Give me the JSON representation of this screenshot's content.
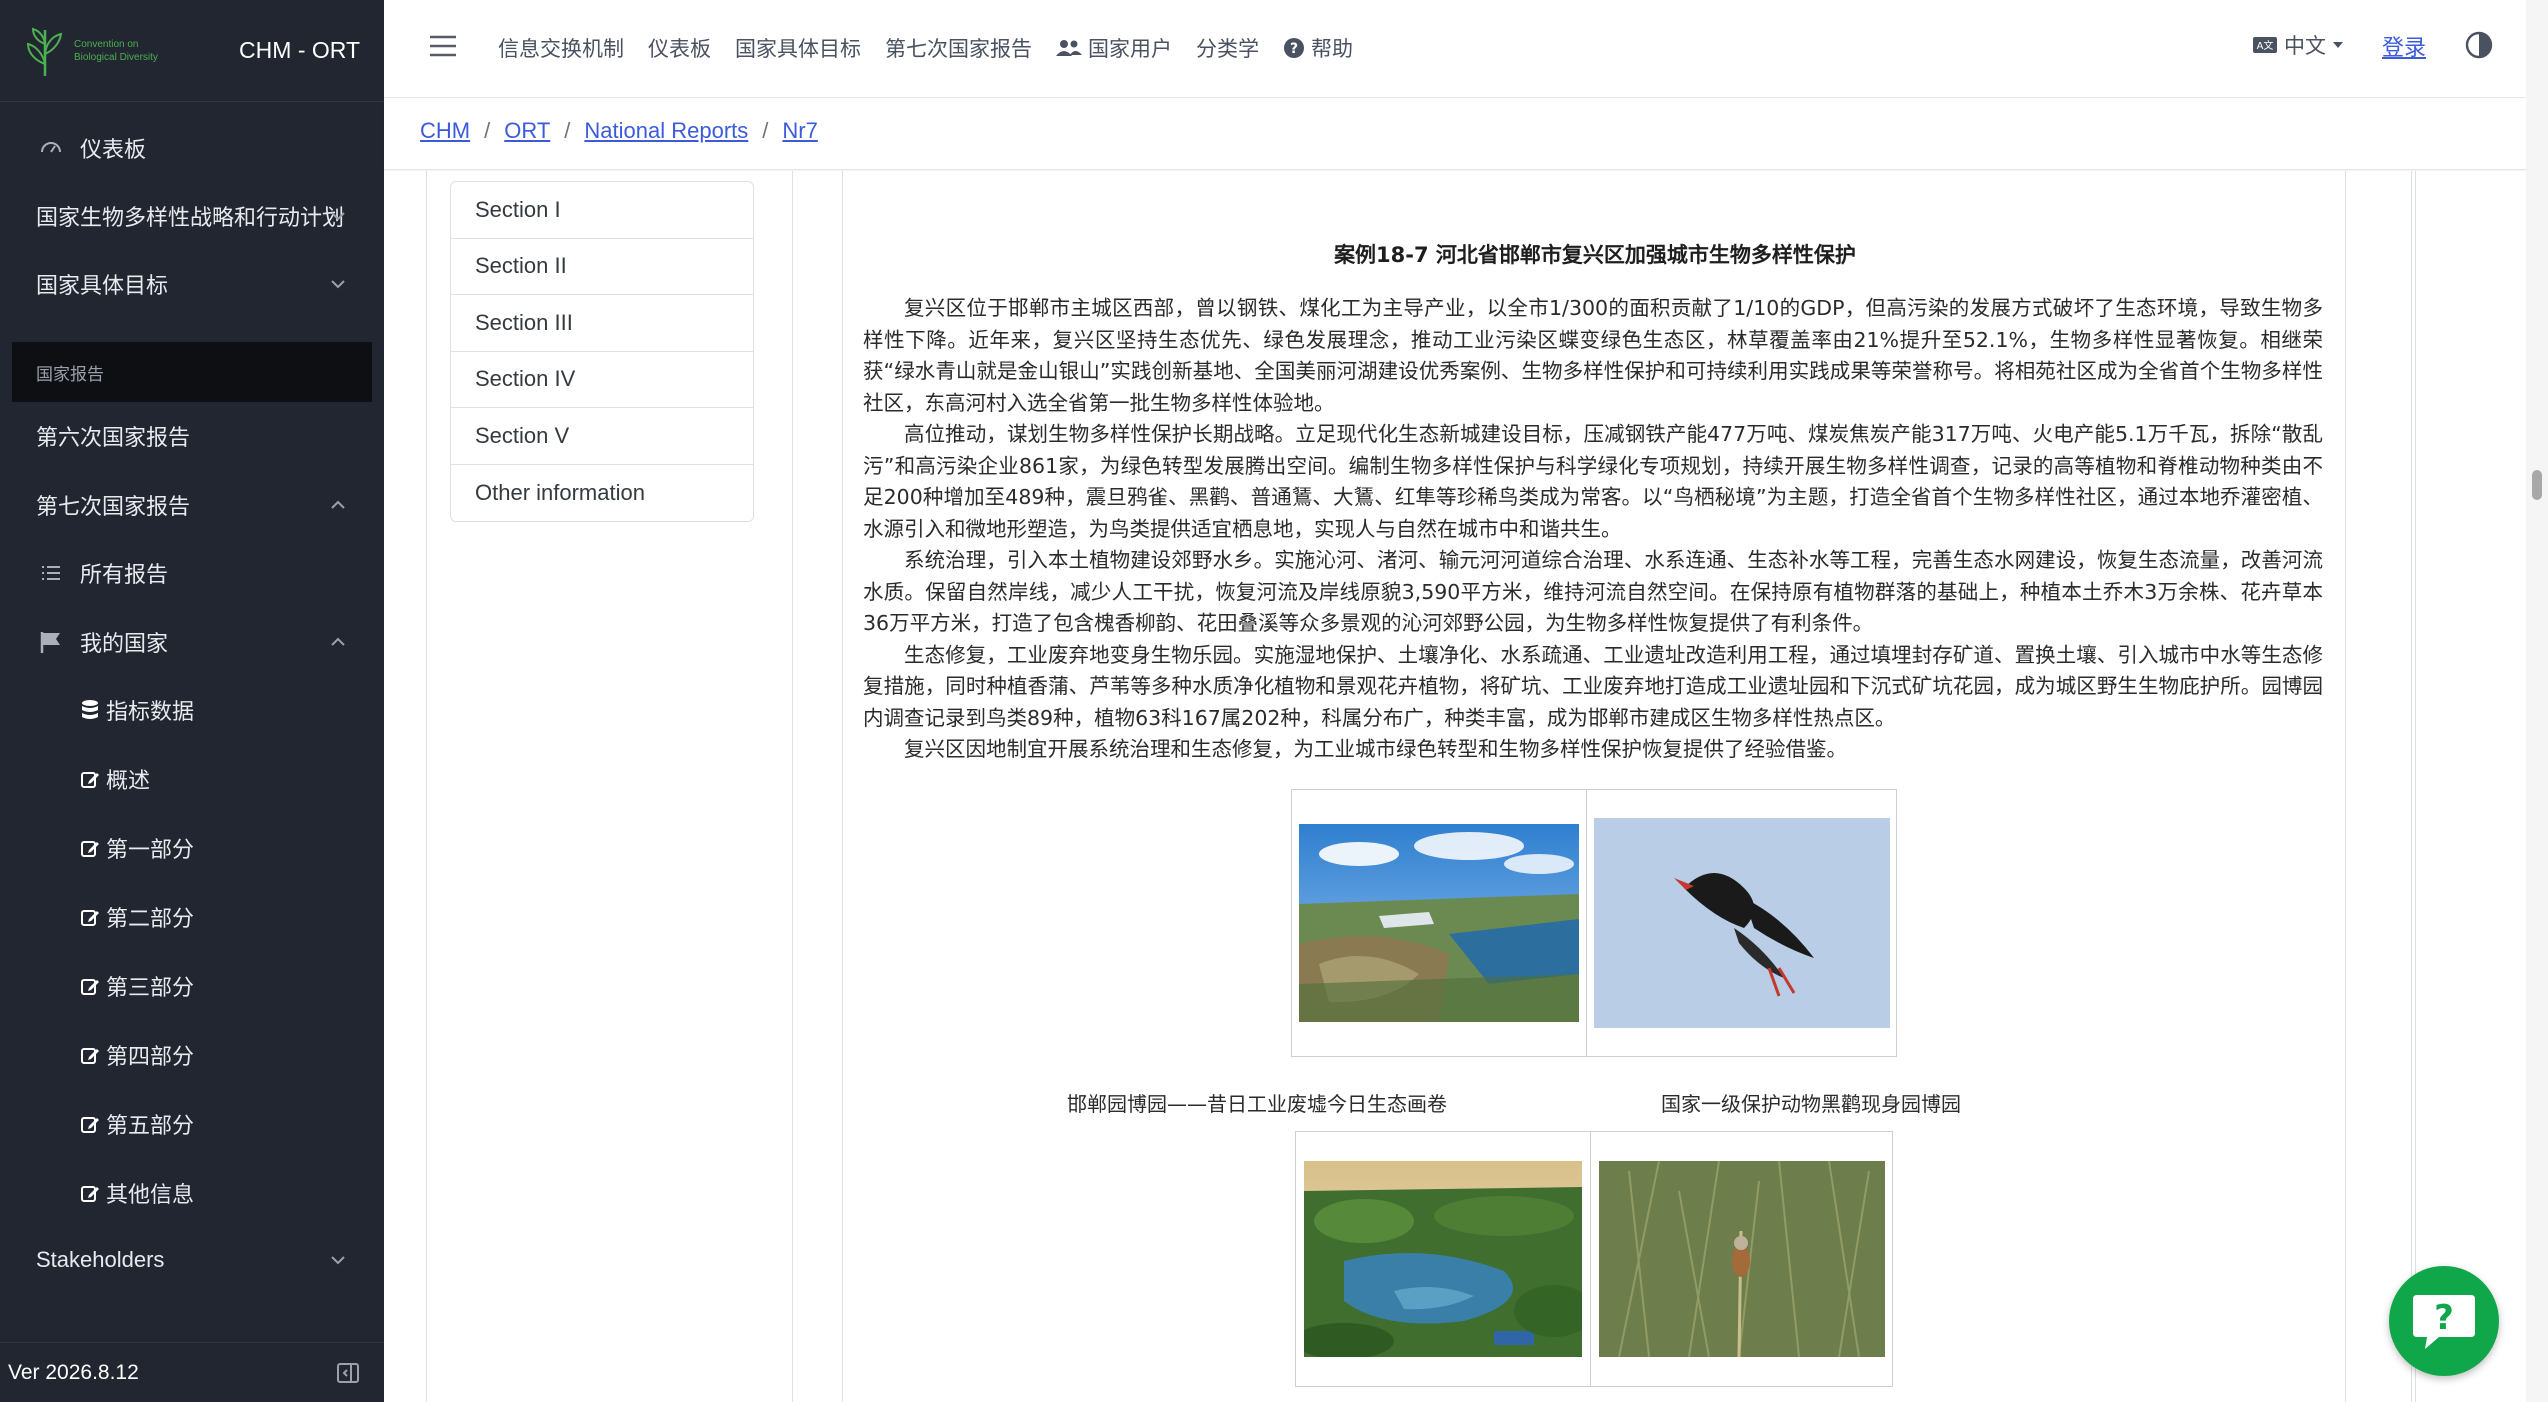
{
  "sidebar": {
    "logo_text": [
      "Convention on",
      "Biological Diversity"
    ],
    "app_name": "CHM - ORT",
    "items": [
      {
        "label": "仪表板",
        "icon": "speedometer-icon"
      },
      {
        "label": "国家生物多样性战略和行动计划",
        "icon": ""
      },
      {
        "label": "国家具体目标",
        "icon": ""
      },
      {
        "label": "第六次国家报告",
        "icon": ""
      },
      {
        "label": "第七次国家报告",
        "icon": ""
      },
      {
        "label": "所有报告",
        "icon": "list-icon"
      },
      {
        "label": "我的国家",
        "icon": "flag-icon"
      },
      {
        "label": "指标数据",
        "icon": "database-icon"
      },
      {
        "label": "概述",
        "icon": "edit-icon"
      },
      {
        "label": "第一部分",
        "icon": "edit-icon"
      },
      {
        "label": "第二部分",
        "icon": "edit-icon"
      },
      {
        "label": "第三部分",
        "icon": "edit-icon"
      },
      {
        "label": "第四部分",
        "icon": "edit-icon"
      },
      {
        "label": "第五部分",
        "icon": "edit-icon"
      },
      {
        "label": "其他信息",
        "icon": "edit-icon"
      },
      {
        "label": "Stakeholders",
        "icon": ""
      }
    ],
    "section_header": "国家报告",
    "version": "Ver 2026.8.12"
  },
  "header": {
    "nav": [
      "信息交换机制",
      "仪表板",
      "国家具体目标",
      "第七次国家报告",
      "国家用户",
      "分类学",
      "帮助"
    ],
    "language": "中文",
    "login": "登录"
  },
  "breadcrumb": [
    "CHM",
    "ORT",
    "National Reports",
    "Nr7"
  ],
  "sections": [
    "Section I",
    "Section II",
    "Section III",
    "Section IV",
    "Section V",
    "Other information"
  ],
  "document": {
    "title": "案例18-7 河北省邯郸市复兴区加强城市生物多样性保护",
    "paragraphs": [
      "复兴区位于邯郸市主城区西部，曾以钢铁、煤化工为主导产业，以全市1/300的面积贡献了1/10的GDP，但高污染的发展方式破坏了生态环境，导致生物多样性下降。近年来，复兴区坚持生态优先、绿色发展理念，推动工业污染区蝶变绿色生态区，林草覆盖率由21%提升至52.1%，生物多样性显著恢复。相继荣获“绿水青山就是金山银山”实践创新基地、全国美丽河湖建设优秀案例、生物多样性保护和可持续利用实践成果等荣誉称号。将相苑社区成为全省首个生物多样性社区，东高河村入选全省第一批生物多样性体验地。",
      "高位推动，谋划生物多样性保护长期战略。立足现代化生态新城建设目标，压减钢铁产能477万吨、煤炭焦炭产能317万吨、火电产能5.1万千瓦，拆除“散乱污”和高污染企业861家，为绿色转型发展腾出空间。编制生物多样性保护与科学绿化专项规划，持续开展生物多样性调查，记录的高等植物和脊椎动物种类由不足200种增加至489种，震旦鸦雀、黑鹳、普通鵟、大鵟、红隼等珍稀鸟类成为常客。以“鸟栖秘境”为主题，打造全省首个生物多样性社区，通过本地乔灌密植、水源引入和微地形塑造，为鸟类提供适宜栖息地，实现人与自然在城市中和谐共生。",
      "系统治理，引入本土植物建设郊野水乡。实施沁河、渚河、输元河河道综合治理、水系连通、生态补水等工程，完善生态水网建设，恢复生态流量，改善河流水质。保留自然岸线，减少人工干扰，恢复河流及岸线原貌3,590平方米，维持河流自然空间。在保持原有植物群落的基础上，种植本土乔木3万余株、花卉草本36万平方米，打造了包含槐香柳韵、花田叠溪等众多景观的沁河郊野公园，为生物多样性恢复提供了有利条件。",
      "生态修复，工业废弃地变身生物乐园。实施湿地保护、土壤净化、水系疏通、工业遗址改造利用工程，通过填埋封存矿道、置换土壤、引入城市中水等生态修复措施，同时种植香蒲、芦苇等多种水质净化植物和景观花卉植物，将矿坑、工业废弃地打造成工业遗址园和下沉式矿坑花园，成为城区野生生物庇护所。园博园内调查记录到鸟类89种，植物63科167属202种，科属分布广，种类丰富，成为邯郸市建成区生物多样性热点区。",
      "复兴区因地制宜开展系统治理和生态修复，为工业城市绿色转型和生物多样性保护恢复提供了经验借鉴。"
    ],
    "captions": [
      "邯郸园博园——昔日工业废墟今日生态画卷",
      "国家一级保护动物黑鹳现身园博园"
    ]
  },
  "colors": {
    "sidebar_bg": "#212631",
    "link": "#3b5bdb",
    "chat_button": "#10a64a"
  }
}
